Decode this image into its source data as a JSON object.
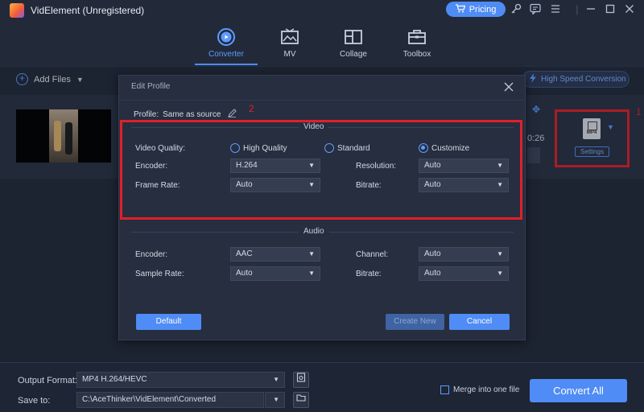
{
  "app": {
    "title": "VidElement (Unregistered)",
    "pricing_label": "Pricing"
  },
  "nav": [
    {
      "label": "Converter",
      "active": true
    },
    {
      "label": "MV",
      "active": false
    },
    {
      "label": "Collage",
      "active": false
    },
    {
      "label": "Toolbox",
      "active": false
    }
  ],
  "toolbar": {
    "add_files_label": "Add Files",
    "high_speed_label": "High Speed Conversion"
  },
  "file_row": {
    "duration": "0:26",
    "format_badge": "MP4",
    "settings_label": "Settings"
  },
  "annotations": {
    "box1": "1",
    "box2": "2"
  },
  "dialog": {
    "title": "Edit Profile",
    "profile_label": "Profile:",
    "profile_value": "Same as source",
    "video_section": "Video",
    "audio_section": "Audio",
    "video": {
      "quality_label": "Video Quality:",
      "quality_options": [
        "High Quality",
        "Standard",
        "Customize"
      ],
      "quality_selected": "Customize",
      "encoder_label": "Encoder:",
      "encoder_value": "H.264",
      "resolution_label": "Resolution:",
      "resolution_value": "Auto",
      "framerate_label": "Frame Rate:",
      "framerate_value": "Auto",
      "bitrate_label": "Bitrate:",
      "bitrate_value": "Auto"
    },
    "audio": {
      "encoder_label": "Encoder:",
      "encoder_value": "AAC",
      "channel_label": "Channel:",
      "channel_value": "Auto",
      "samplerate_label": "Sample Rate:",
      "samplerate_value": "Auto",
      "bitrate_label": "Bitrate:",
      "bitrate_value": "Auto"
    },
    "buttons": {
      "default": "Default",
      "create_new": "Create New",
      "cancel": "Cancel"
    }
  },
  "bottom": {
    "output_format_label": "Output Format:",
    "output_format_value": "MP4 H.264/HEVC",
    "save_to_label": "Save to:",
    "save_to_value": "C:\\AceThinker\\VidElement\\Converted",
    "merge_label": "Merge into one file",
    "convert_all_label": "Convert All"
  },
  "colors": {
    "accent": "#4f8cf5",
    "annotation": "#e0202a",
    "background": "#222a3a"
  }
}
